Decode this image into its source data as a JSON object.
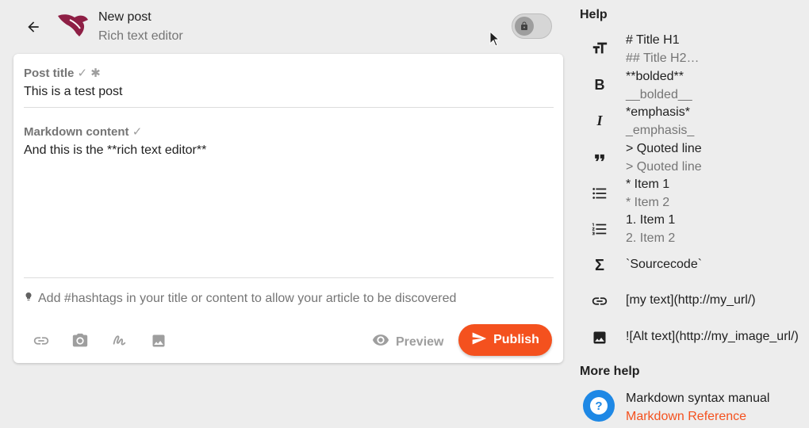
{
  "header": {
    "title": "New post",
    "subtitle": "Rich text editor"
  },
  "editor": {
    "title_label": "Post title",
    "title_value": "This is a test post",
    "content_label": "Markdown content",
    "content_value": "And this is the **rich text editor**",
    "hashtag_hint": "Add #hashtags in your title or content to allow your article to be discovered",
    "preview_label": "Preview",
    "publish_label": "Publish"
  },
  "help": {
    "title": "Help",
    "rows": [
      {
        "icon": "text-size-icon",
        "line1": "# Title H1",
        "line2": "## Title H2…"
      },
      {
        "icon": "bold-icon",
        "line1": "**bolded**",
        "line2": "__bolded__"
      },
      {
        "icon": "italic-icon",
        "line1": "*emphasis*",
        "line2": "_emphasis_"
      },
      {
        "icon": "quote-icon",
        "line1": "> Quoted line",
        "line2": "> Quoted line"
      },
      {
        "icon": "bulleted-list-icon",
        "line1": "* Item 1",
        "line2": "* Item 2"
      },
      {
        "icon": "numbered-list-icon",
        "line1": "1. Item 1",
        "line2": "2. Item 2"
      },
      {
        "icon": "sigma-icon",
        "line1": "`Sourcecode`",
        "line2": ""
      },
      {
        "icon": "link-icon",
        "line1": "[my text](http://my_url/)",
        "line2": ""
      },
      {
        "icon": "image-icon",
        "line1": "![Alt text](http://my_image_url/)",
        "line2": ""
      }
    ],
    "more_title": "More help",
    "more_line1": "Markdown syntax manual",
    "more_line2": "Markdown Reference"
  },
  "colors": {
    "accent": "#f4511e",
    "help_blue": "#1e88e5",
    "logo": "#8e1f45"
  }
}
